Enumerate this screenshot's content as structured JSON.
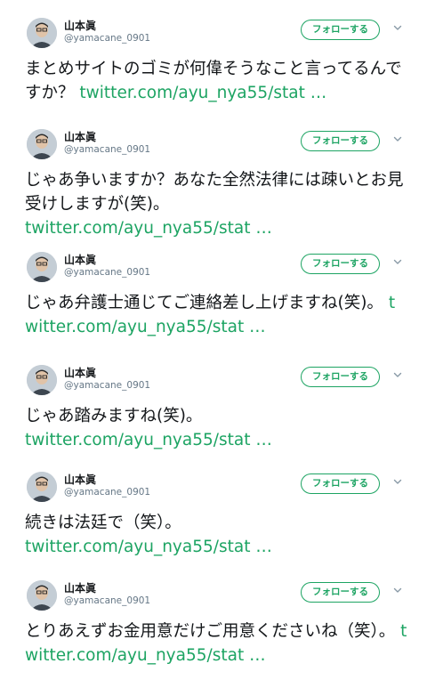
{
  "colors": {
    "link": "#1da463",
    "follow_button_border": "#1da463",
    "handle_gray": "#657786",
    "text_dark": "#14171a"
  },
  "icons": {
    "avatar": "user-avatar-photo",
    "caret": "chevron-down-icon"
  },
  "tweets": [
    {
      "author_name": "山本眞",
      "handle": "@yamacane_0901",
      "follow_label": "フォローする",
      "text": "まとめサイトのゴミが何偉そうなこと言ってるんですか？",
      "link": "twitter.com/ayu_nya55/stat …"
    },
    {
      "author_name": "山本眞",
      "handle": "@yamacane_0901",
      "follow_label": "フォローする",
      "text": "じゃあ争いますか？あなた全然法律には疎いとお見受けしますが(笑)。",
      "link": "twitter.com/ayu_nya55/stat …"
    },
    {
      "author_name": "山本眞",
      "handle": "@yamacane_0901",
      "follow_label": "フォローする",
      "text": "じゃあ弁護士通じてご連絡差し上げますね(笑)。",
      "link": "twitter.com/ayu_nya55/stat …"
    },
    {
      "author_name": "山本眞",
      "handle": "@yamacane_0901",
      "follow_label": "フォローする",
      "text": "じゃあ踏みますね(笑)。",
      "link": "twitter.com/ayu_nya55/stat …"
    },
    {
      "author_name": "山本眞",
      "handle": "@yamacane_0901",
      "follow_label": "フォローする",
      "text": "続きは法廷で（笑）。",
      "link": "twitter.com/ayu_nya55/stat …"
    },
    {
      "author_name": "山本眞",
      "handle": "@yamacane_0901",
      "follow_label": "フォローする",
      "text": "とりあえずお金用意だけご用意くださいね（笑）。",
      "link": "twitter.com/ayu_nya55/stat …"
    }
  ]
}
